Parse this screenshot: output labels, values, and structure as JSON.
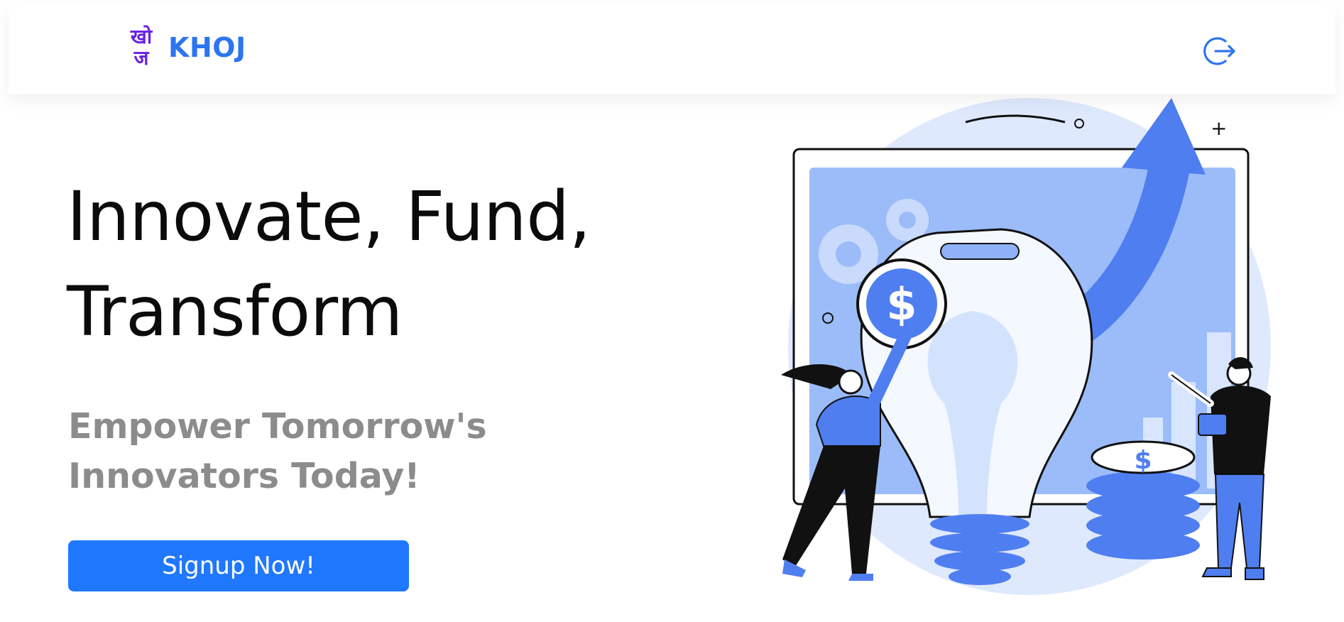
{
  "navbar": {
    "logo_line1": "खो",
    "logo_line2": "ज",
    "brand_name": "KHOJ",
    "logout_icon": "logout-icon"
  },
  "hero": {
    "title_line1": "Innovate, Fund,",
    "title_line2": "Transform",
    "subtitle_line1": "Empower Tomorrow's",
    "subtitle_line2": "Innovators Today!",
    "cta_label": "Signup Now!",
    "illustration": "lightbulb-growth-illustration"
  },
  "colors": {
    "brand_purple": "#6a1fe0",
    "brand_blue": "#2d75f0",
    "cta_blue": "#1f78ff",
    "subtitle_gray": "#8c8c8c",
    "illustration_blue": "#4f7ef0",
    "illustration_light": "#c9dafc"
  }
}
